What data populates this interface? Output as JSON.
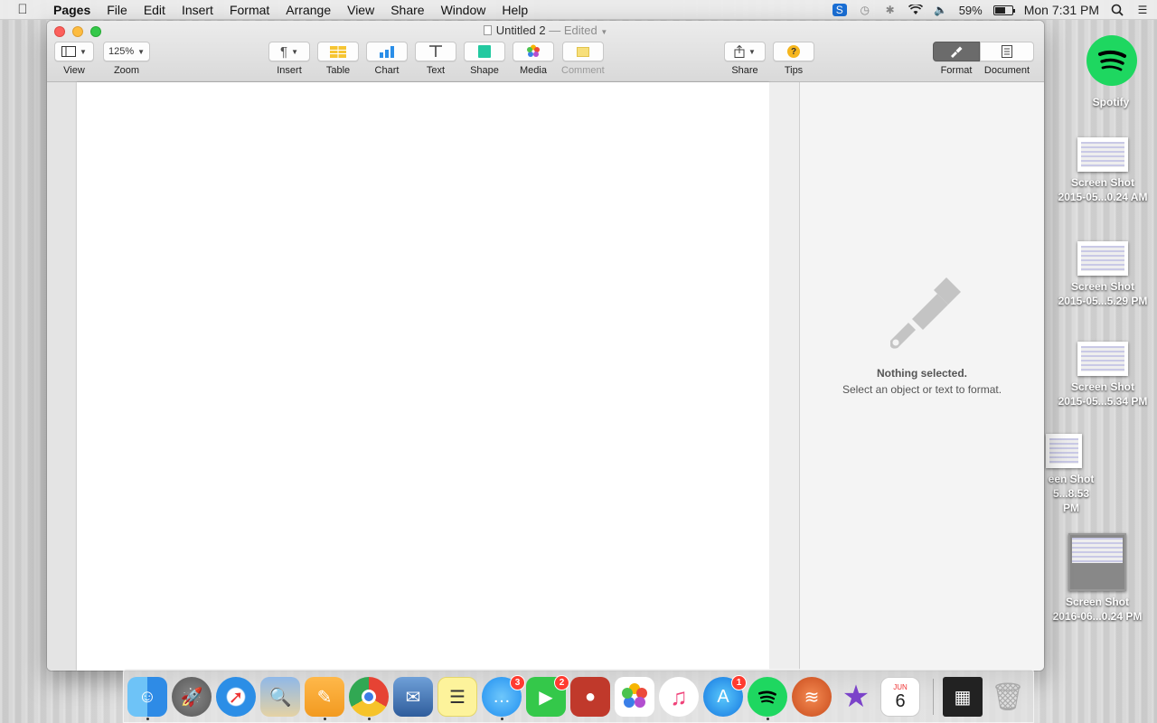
{
  "menubar": {
    "app_name": "Pages",
    "items": [
      "File",
      "Edit",
      "Insert",
      "Format",
      "Arrange",
      "View",
      "Share",
      "Window",
      "Help"
    ],
    "battery_percent": "59%",
    "clock": "Mon 7:31 PM"
  },
  "window": {
    "title": "Untitled 2",
    "edited_suffix": "— Edited",
    "toolbar": {
      "view_label": "View",
      "zoom_value": "125%",
      "zoom_label": "Zoom",
      "insert_label": "Insert",
      "table_label": "Table",
      "chart_label": "Chart",
      "text_label": "Text",
      "shape_label": "Shape",
      "media_label": "Media",
      "comment_label": "Comment",
      "share_label": "Share",
      "tips_label": "Tips",
      "format_label": "Format",
      "document_label": "Document"
    },
    "inspector": {
      "title": "Nothing selected.",
      "subtitle": "Select an object or text to format."
    }
  },
  "desktop": {
    "spotify_label": "Spotify",
    "screenshots": [
      {
        "line1": "Screen Shot",
        "line2": "2015-05...0.24 AM"
      },
      {
        "line1": "Screen Shot",
        "line2": "2015-05...5.29 PM"
      },
      {
        "line1": "Screen Shot",
        "line2": "2015-05...5.34 PM"
      },
      {
        "line1": "een Shot",
        "line2": "5...8.53 PM"
      },
      {
        "line1": "Screen Shot",
        "line2": "2016-06...0.24 PM"
      }
    ]
  },
  "dock": {
    "messages_badge": "3",
    "facetime_badge": "2",
    "appstore_badge": "1",
    "calendar_month": "JUN",
    "calendar_day": "6"
  },
  "colors": {
    "accent_green": "#1ed760",
    "badge_red": "#ff3b30"
  }
}
